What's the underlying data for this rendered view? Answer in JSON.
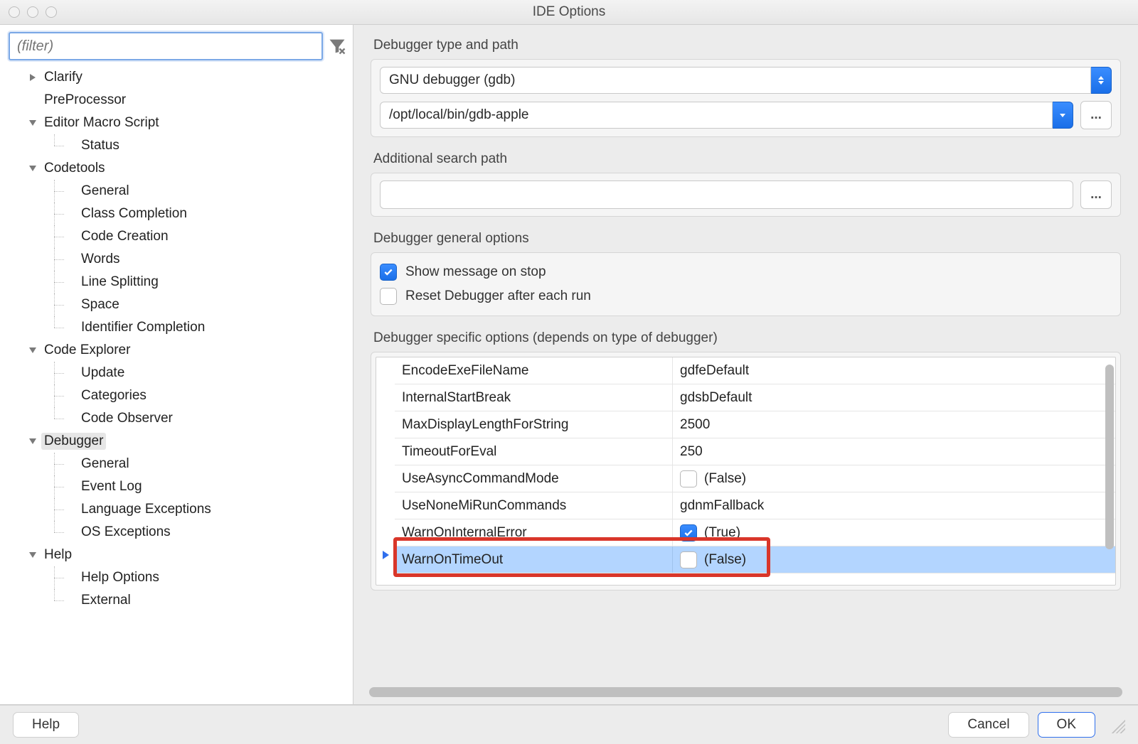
{
  "window": {
    "title": "IDE Options"
  },
  "filter": {
    "placeholder": "(filter)"
  },
  "tree": {
    "clarify": "Clarify",
    "preprocessor": "PreProcessor",
    "editor_macro_script": "Editor Macro Script",
    "status": "Status",
    "codetools": "Codetools",
    "ct_general": "General",
    "ct_class_completion": "Class Completion",
    "ct_code_creation": "Code Creation",
    "ct_words": "Words",
    "ct_line_splitting": "Line Splitting",
    "ct_space": "Space",
    "ct_identifier_completion": "Identifier Completion",
    "code_explorer": "Code Explorer",
    "ce_update": "Update",
    "ce_categories": "Categories",
    "ce_code_observer": "Code Observer",
    "debugger": "Debugger",
    "dbg_general": "General",
    "dbg_event_log": "Event Log",
    "dbg_lang_exceptions": "Language Exceptions",
    "dbg_os_exceptions": "OS Exceptions",
    "help": "Help",
    "help_options": "Help Options",
    "help_external": "External"
  },
  "main": {
    "section_type_path": "Debugger type and path",
    "debugger_type": "GNU debugger (gdb)",
    "debugger_path": "/opt/local/bin/gdb-apple",
    "section_search_path": "Additional search path",
    "search_path": "",
    "section_general": "Debugger general options",
    "show_message_on_stop": {
      "label": "Show message on stop",
      "checked": true
    },
    "reset_after_run": {
      "label": "Reset Debugger after each run",
      "checked": false
    },
    "section_specific": "Debugger specific options (depends on type of debugger)",
    "grid": [
      {
        "name": "EncodeExeFileName",
        "value": "gdfeDefault"
      },
      {
        "name": "InternalStartBreak",
        "value": "gdsbDefault"
      },
      {
        "name": "MaxDisplayLengthForString",
        "value": "2500"
      },
      {
        "name": "TimeoutForEval",
        "value": "250"
      },
      {
        "name": "UseAsyncCommandMode",
        "value": "(False)",
        "checkbox": true,
        "checked": false
      },
      {
        "name": "UseNoneMiRunCommands",
        "value": "gdnmFallback"
      },
      {
        "name": "WarnOnInternalError",
        "value": "(True)",
        "checkbox": true,
        "checked": true
      },
      {
        "name": "WarnOnTimeOut",
        "value": "(False)",
        "checkbox": true,
        "checked": false,
        "selected": true,
        "highlighted": true
      }
    ]
  },
  "footer": {
    "help": "Help",
    "cancel": "Cancel",
    "ok": "OK"
  },
  "misc": {
    "ellipsis": "..."
  }
}
